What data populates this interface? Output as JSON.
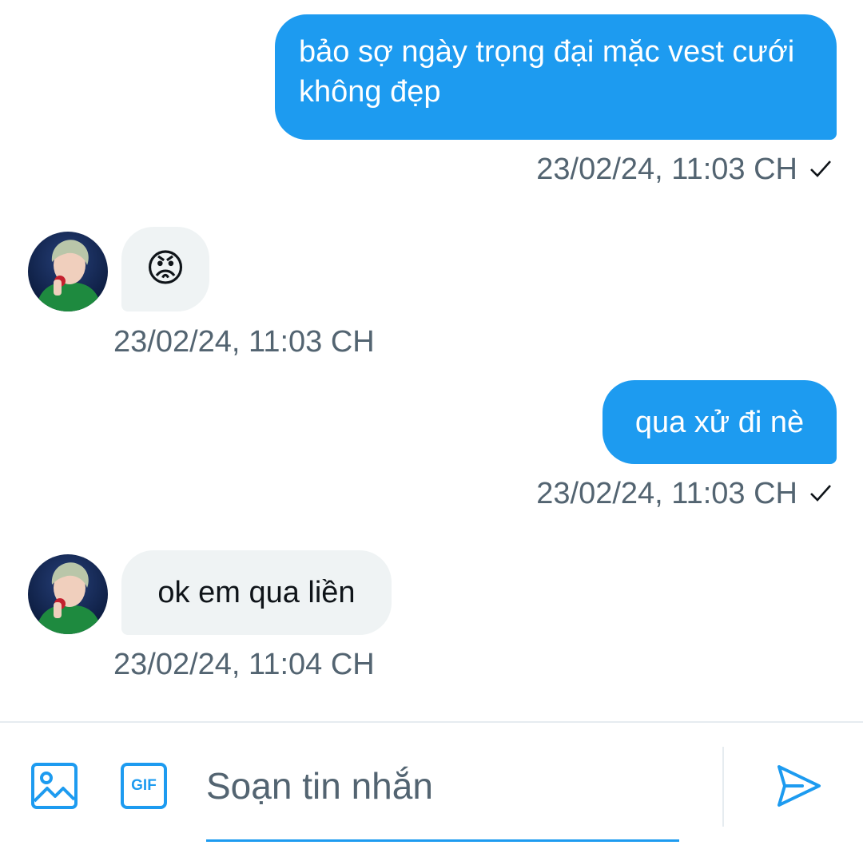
{
  "messages": [
    {
      "direction": "outgoing",
      "text": "bảo sợ ngày trọng đại mặc vest cưới không đẹp",
      "timestamp": "23/02/24, 11:03 CH",
      "status": "sent"
    },
    {
      "direction": "incoming",
      "emoji": "😡",
      "timestamp": "23/02/24, 11:03 CH"
    },
    {
      "direction": "outgoing",
      "text": "qua xử đi nè",
      "timestamp": "23/02/24, 11:03 CH",
      "status": "sent"
    },
    {
      "direction": "incoming",
      "text": "ok em qua liền",
      "timestamp": "23/02/24, 11:04 CH"
    }
  ],
  "composer": {
    "placeholder": "Soạn tin nhắn",
    "gif_label": "GIF",
    "icons": [
      "image-icon",
      "gif-icon",
      "send-icon"
    ]
  },
  "colors": {
    "accent": "#1d9bf0",
    "incoming_bubble": "#eff3f4",
    "timestamp": "#536471"
  }
}
